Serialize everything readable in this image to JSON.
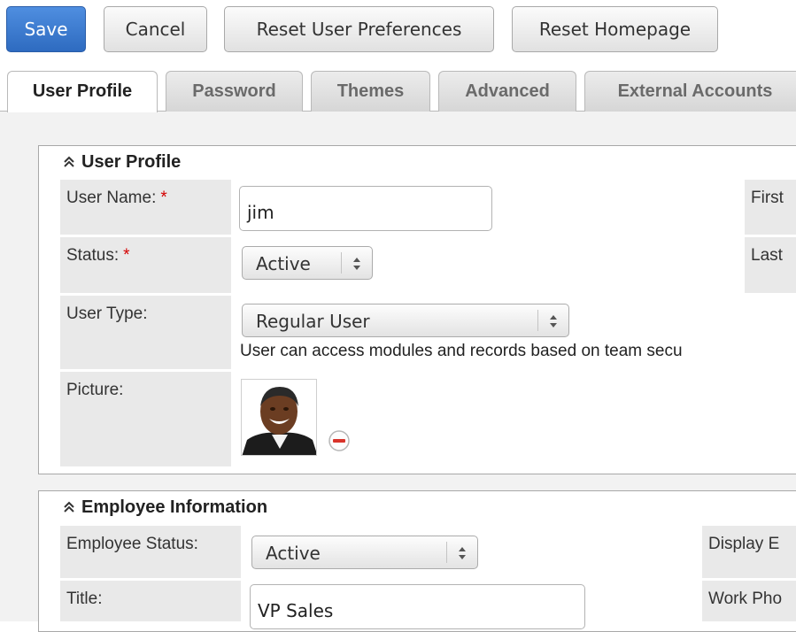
{
  "toolbar": {
    "save_label": "Save",
    "cancel_label": "Cancel",
    "reset_prefs_label": "Reset User Preferences",
    "reset_home_label": "Reset Homepage"
  },
  "tabs": [
    {
      "label": "User Profile",
      "active": true
    },
    {
      "label": "Password",
      "active": false
    },
    {
      "label": "Themes",
      "active": false
    },
    {
      "label": "Advanced",
      "active": false
    },
    {
      "label": "External Accounts",
      "active": false
    }
  ],
  "user_profile": {
    "title": "User Profile",
    "user_name_label": "User Name:",
    "user_name_value": "jim",
    "status_label": "Status:",
    "status_value": "Active",
    "user_type_label": "User Type:",
    "user_type_value": "Regular User",
    "user_type_help": "User can access modules and records based on team secu",
    "picture_label": "Picture:",
    "first_label": "First",
    "last_label": "Last",
    "required_mark": "*"
  },
  "employee_info": {
    "title": "Employee Information",
    "employee_status_label": "Employee Status:",
    "employee_status_value": "Active",
    "title_label": "Title:",
    "title_value": "VP Sales",
    "display_label": "Display E",
    "work_phone_label": "Work Pho"
  },
  "colors": {
    "primary_button": "#2e6bc0",
    "required": "#d40000",
    "remove_icon": "#d9342b",
    "label_bg": "#e9e9e9"
  },
  "icons": {
    "collapse": "double-chevron-up-icon",
    "select": "up-down-arrows-icon",
    "remove": "minus-circle-icon"
  }
}
